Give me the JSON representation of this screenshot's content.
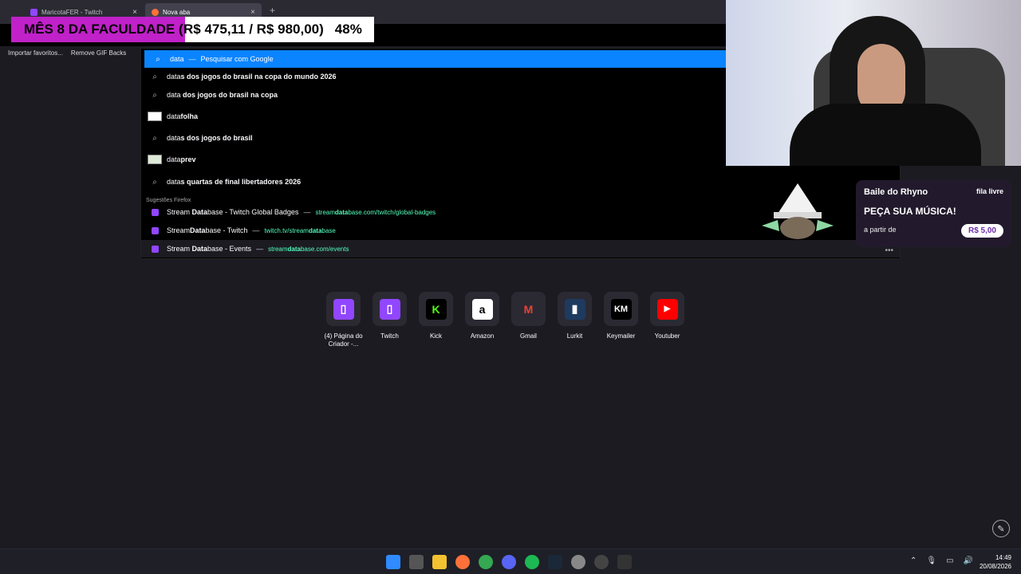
{
  "tabs": [
    {
      "label": "MaricotaFER - Twitch",
      "close": "×"
    },
    {
      "label": "Nova aba",
      "close": "×"
    }
  ],
  "new_tab": "+",
  "bookmarks": [
    "Importar favoritos...",
    "Remove GIF Backs"
  ],
  "goal_overlay": {
    "label": "MÊS 8 DA FACULDADE (",
    "amount": "R$ 475,11 / R$ 980,00)",
    "percent": "48%",
    "accent": "#c021c9"
  },
  "search": {
    "query": "data",
    "engine_hint": "Pesquisar com Google",
    "section_label": "Sugestões Firefox",
    "suggestions": [
      {
        "prefix": "data",
        "bold": "s dos jogos do brasil na copa do mundo 2026"
      },
      {
        "prefix": "data",
        "bold": " dos jogos do brasil na copa"
      },
      {
        "prefix": "data",
        "bold": "folha"
      },
      {
        "prefix": "data",
        "bold": "s dos jogos do brasil"
      },
      {
        "prefix": "data",
        "bold": "prev"
      },
      {
        "prefix": "data",
        "bold": "s quartas de final libertadores 2026"
      }
    ],
    "firefox": [
      {
        "title_a": "Stream ",
        "title_b": "Data",
        "title_c": "base - Twitch Global Badges",
        "url_a": "stream",
        "url_b": "data",
        "url_c": "base.com/twitch/global-badges"
      },
      {
        "title_a": "Stream",
        "title_b": "Data",
        "title_c": "base - Twitch",
        "url_a": "twitch.tv/stream",
        "url_b": "data",
        "url_c": "base"
      },
      {
        "title_a": "Stream ",
        "title_b": "Data",
        "title_c": "base - Events",
        "url_a": "stream",
        "url_b": "data",
        "url_c": "base.com/events"
      }
    ],
    "separator": "—",
    "more": "•••"
  },
  "music_widget": {
    "header": "Baile do Rhyno",
    "badge": "fila livre",
    "title": "PEÇA SUA MÚSICA!",
    "from": "a partir de",
    "price": "R$ 5,00"
  },
  "shortcuts": [
    {
      "label": "(4) Página do Criador -...",
      "icon": "twitch-icon",
      "glyph": "▯",
      "color": "#9146ff"
    },
    {
      "label": "Twitch",
      "icon": "twitch-icon",
      "glyph": "▯",
      "color": "#9146ff"
    },
    {
      "label": "Kick",
      "icon": "kick-icon",
      "glyph": "K",
      "color": "#53fc18"
    },
    {
      "label": "Amazon",
      "icon": "amazon-icon",
      "glyph": "a",
      "color": "#ffffff"
    },
    {
      "label": "Gmail",
      "icon": "gmail-icon",
      "glyph": "M",
      "color": "#ea4335"
    },
    {
      "label": "Lurkit",
      "icon": "lurkit-icon",
      "glyph": "▮",
      "color": "#1e3a5f"
    },
    {
      "label": "Keymailer",
      "icon": "keymailer-icon",
      "glyph": "KM",
      "color": "#2b2a33"
    },
    {
      "label": "Youtuber",
      "icon": "youtube-icon",
      "glyph": "▶",
      "color": "#ff0000"
    }
  ],
  "clock": {
    "time": "14:49",
    "date": "20/08/2026"
  }
}
